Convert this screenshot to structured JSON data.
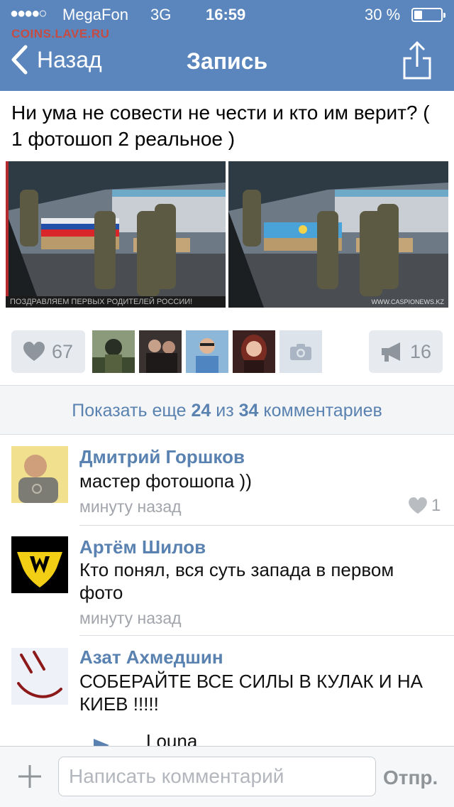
{
  "status_bar": {
    "signal": "●●●●○",
    "carrier": "MegaFon",
    "network": "3G",
    "time": "16:59",
    "battery": "30 %",
    "battery_level": 0.3
  },
  "watermark": "COINS.LAVE.RU",
  "nav": {
    "back_label": "Назад",
    "title": "Запись"
  },
  "post": {
    "text": "Ни  ума не совести не чести и кто им верит?  ( 1 фотошоп 2 реальное )",
    "photo1_caption": "ПОЗДРАВЛЯЕМ ПЕРВЫХ РОДИТЕЛЕЙ РОССИИ!",
    "photo2_caption": "WWW.CASPIONEWS.KZ"
  },
  "actions": {
    "likes": "67",
    "reposts": "16"
  },
  "show_more": {
    "prefix": "Показать еще",
    "shown": "24",
    "middle": "из",
    "total": "34",
    "suffix": "комментариев"
  },
  "comments": [
    {
      "author": "Дмитрий Горшков",
      "text": "мастер фотошопа ))",
      "time": "минуту назад",
      "likes": "1"
    },
    {
      "author": "Артём Шилов",
      "text": "Кто понял, вся суть запада в первом фото",
      "time": "минуту назад"
    },
    {
      "author": "Азат Ахмедшин",
      "text": "СОБЕРАЙТЕ ВСЕ СИЛЫ В КУЛАК И НА КИЕВ !!!!!",
      "attachment": "Louna"
    }
  ],
  "composer": {
    "placeholder": "Написать комментарий",
    "send_label": "Отпр."
  },
  "colors": {
    "header": "#5b86bd",
    "link": "#5a82b1",
    "muted": "#a1a5ab"
  }
}
